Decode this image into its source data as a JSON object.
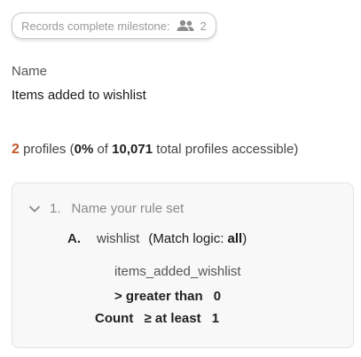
{
  "chip": {
    "label": "Records complete milestone:",
    "icon": "people-icon",
    "count": "2"
  },
  "name": {
    "label": "Name",
    "value": "Items added to wishlist"
  },
  "profiles": {
    "count": "2",
    "word": "profiles",
    "open": " (",
    "percent": "0%",
    "of": " of ",
    "total": "10,071",
    "suffix": " total profiles accessible)",
    "accent_color": "#c0582a"
  },
  "ruleset": {
    "toggle_icon": "chevron-down-icon",
    "number": "1.",
    "title": "Name your rule set",
    "rule": {
      "letter": "A.",
      "event": "wishlist",
      "logic_prefix": "(Match logic: ",
      "logic_value": "all",
      "logic_suffix": ")",
      "property": "items_added_wishlist",
      "operator": "> greater than",
      "operator_value": "0",
      "count_label": "Count",
      "count_operator": "≥ at least",
      "count_value": "1"
    }
  }
}
